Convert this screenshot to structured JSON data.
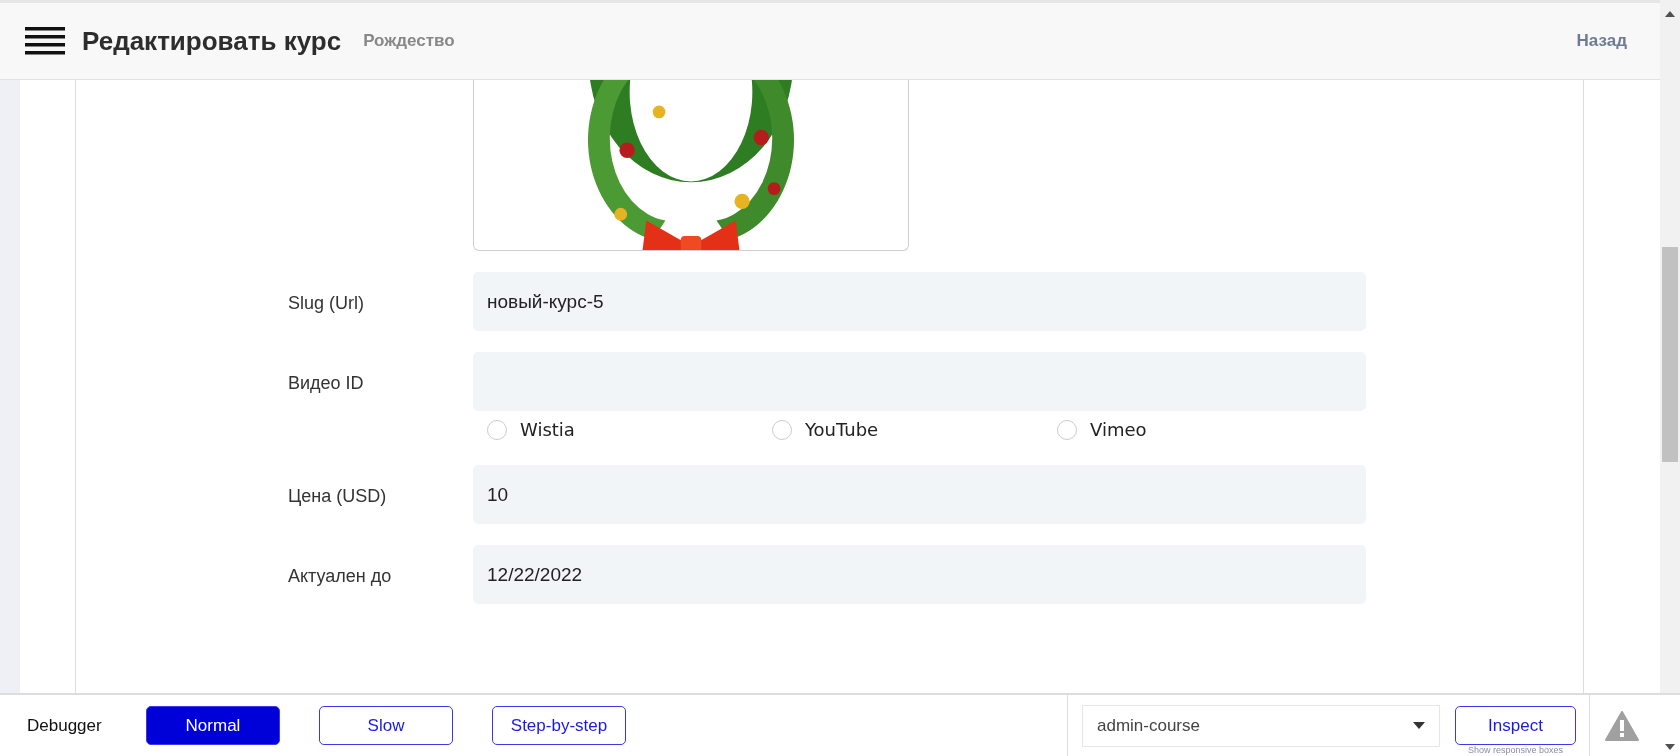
{
  "header": {
    "title": "Редактировать курс",
    "subtitle": "Рождество",
    "back_link": "Назад"
  },
  "fields": [
    {
      "label": "Slug (Url)",
      "value": "новый-курс-5"
    },
    {
      "label": "Видео ID",
      "radios": [
        {
          "label": "Wistia",
          "selected": false
        },
        {
          "label": "YouTube",
          "selected": false
        },
        {
          "label": "Vimeo",
          "selected": false
        }
      ]
    },
    {
      "label": "Цена (USD)",
      "value": "10"
    },
    {
      "label": "Актуален до",
      "value": "12/22/2022"
    }
  ],
  "debugger": {
    "label": "Debugger",
    "modes": [
      {
        "label": "Normal",
        "selected": true
      },
      {
        "label": "Slow",
        "selected": false
      },
      {
        "label": "Step-by-step",
        "selected": false
      }
    ],
    "select_value": "admin-course",
    "inspect": "Inspect",
    "hint": "Show responsive boxes"
  }
}
